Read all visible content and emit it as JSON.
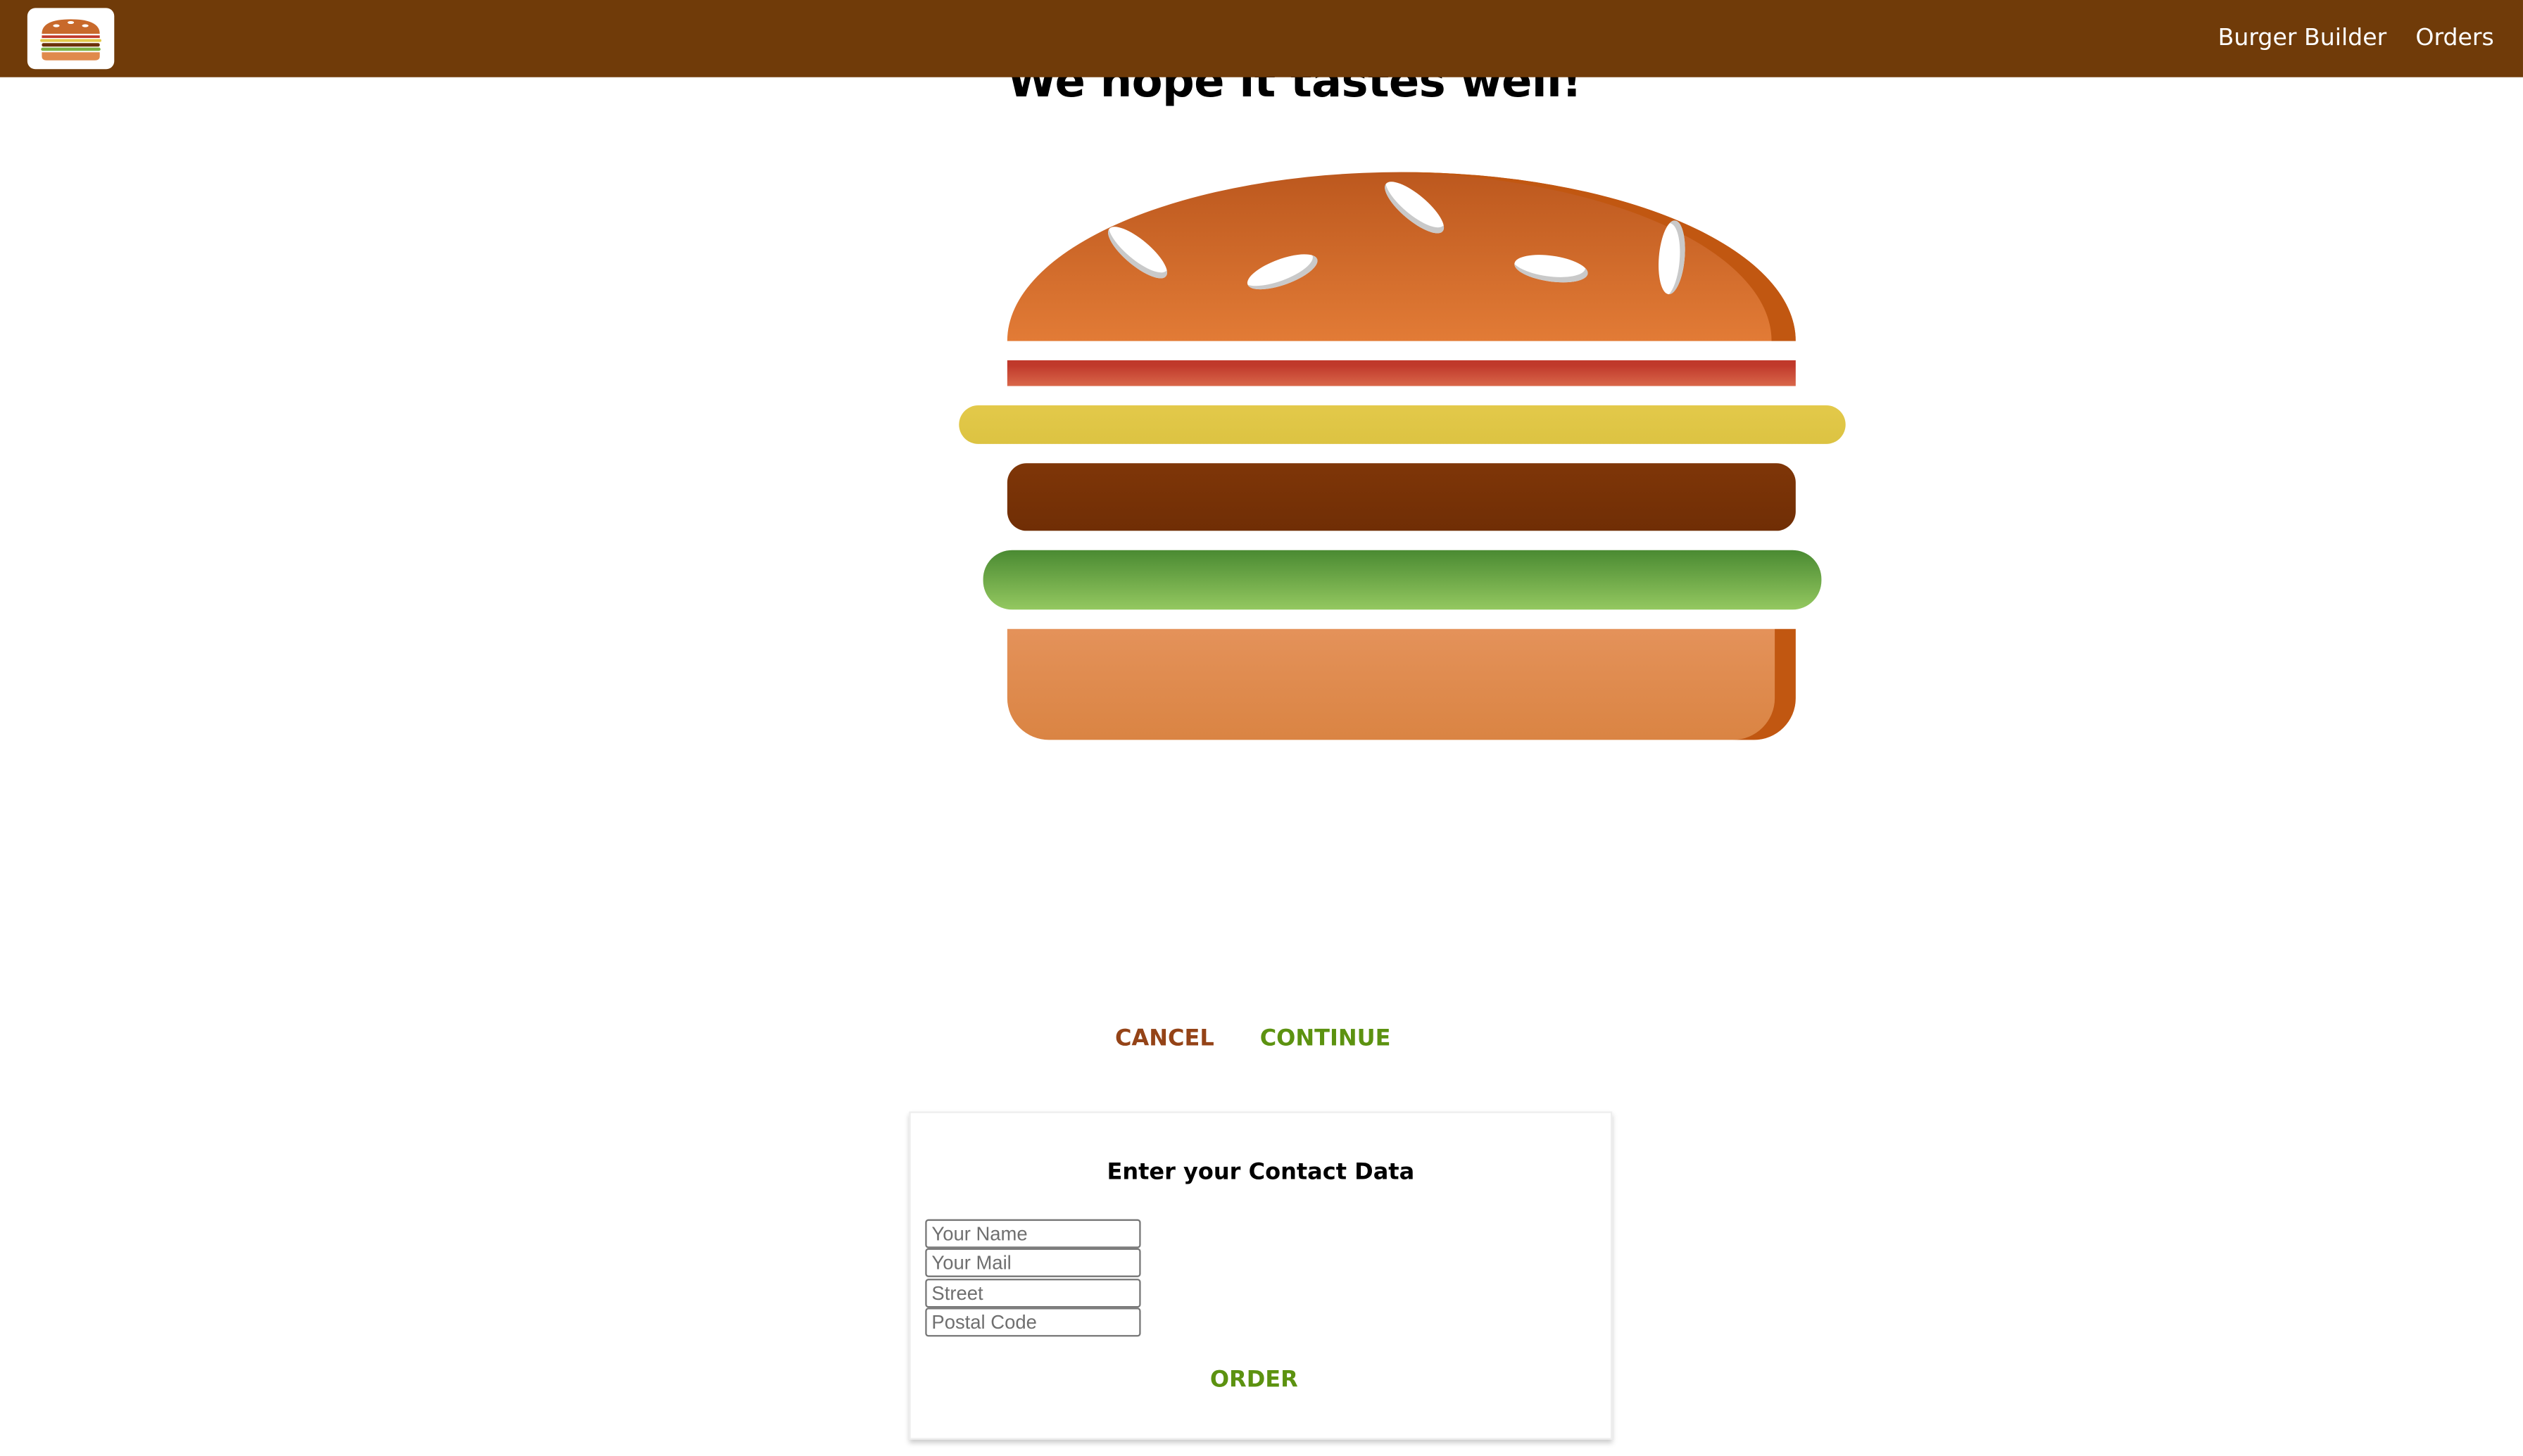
{
  "toolbar": {
    "logo_alt": "MyBurger",
    "nav": [
      {
        "label": "Burger Builder"
      },
      {
        "label": "Orders"
      }
    ]
  },
  "checkout": {
    "title": "We hope it tastes well!",
    "burger_layers": [
      "bread-top",
      "bacon",
      "cheese",
      "meat",
      "salad",
      "bread-bottom"
    ],
    "cancel_label": "CANCEL",
    "continue_label": "CONTINUE"
  },
  "contact": {
    "title": "Enter your Contact Data",
    "fields": [
      {
        "name": "name",
        "placeholder": "Your Name",
        "value": ""
      },
      {
        "name": "email",
        "placeholder": "Your Mail",
        "value": ""
      },
      {
        "name": "street",
        "placeholder": "Street",
        "value": ""
      },
      {
        "name": "postal",
        "placeholder": "Postal Code",
        "value": ""
      }
    ],
    "order_label": "ORDER"
  },
  "colors": {
    "toolbar": "#703b09",
    "danger": "#944317",
    "success": "#5c9210"
  }
}
